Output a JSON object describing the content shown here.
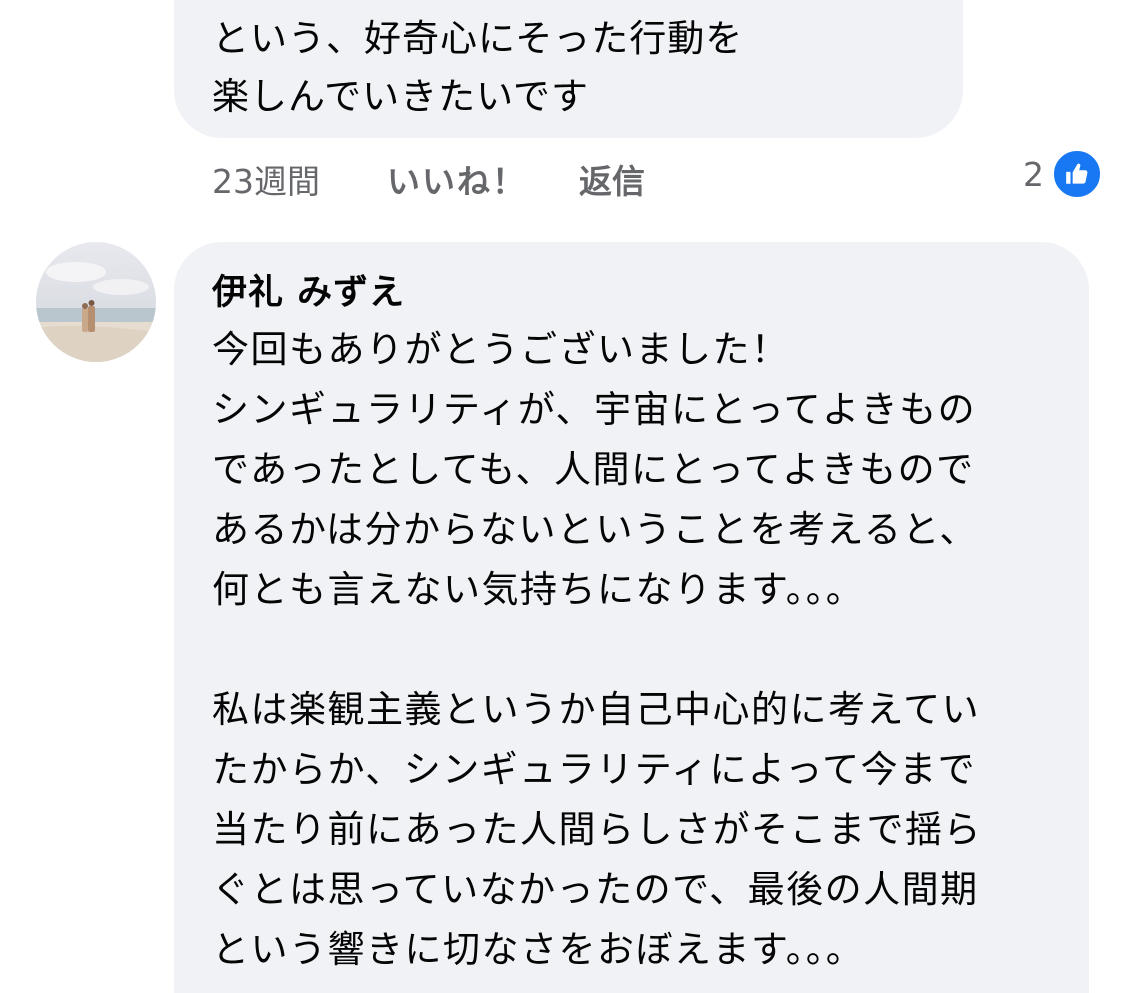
{
  "previous_comment": {
    "lines": [
      "という、好奇心にそった行動を",
      "楽しんでいきたいです"
    ],
    "timestamp": "23週間",
    "like_label": "いいね！",
    "reply_label": "返信",
    "reaction_count": "2",
    "reaction_icon": "thumbs-up-icon",
    "accent_color": "#1877f2"
  },
  "comment": {
    "author": "伊礼 みずえ",
    "paragraph1": [
      "今回もありがとうございました！",
      "シンギュラリティが、宇宙にとってよきもの",
      "であったとしても、人間にとってよきもので",
      "あるかは分からないということを考えると、",
      "何とも言えない気持ちになります。。。"
    ],
    "paragraph2": [
      "私は楽観主義というか自己中心的に考えてい",
      "たからか、シンギュラリティによって今まで",
      "当たり前にあった人間らしさがそこまで揺ら",
      "ぐとは思っていなかったので、最後の人間期",
      "という響きに切なさをおぼえます。。。"
    ]
  },
  "colors": {
    "bubble": "#f0f2f5",
    "secondary_text": "#65676b",
    "primary_text": "#050505"
  }
}
